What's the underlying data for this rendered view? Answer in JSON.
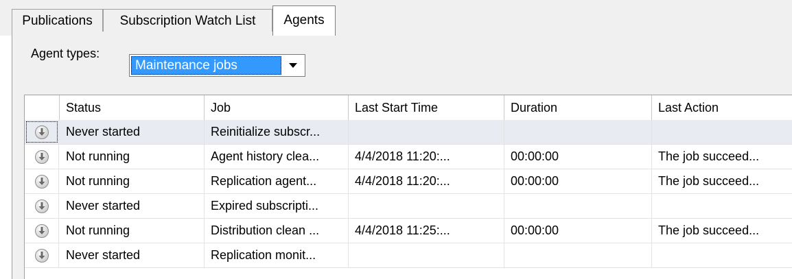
{
  "tabs": [
    {
      "label": "Publications"
    },
    {
      "label": "Subscription Watch List"
    },
    {
      "label": "Agents"
    }
  ],
  "agent_types": {
    "label": "Agent types:",
    "selected": "Maintenance jobs"
  },
  "grid": {
    "columns": [
      "",
      "Status",
      "Job",
      "Last Start Time",
      "Duration",
      "Last Action"
    ],
    "rows": [
      {
        "icon": "job-status-icon",
        "status": "Never started",
        "job": "Reinitialize subscr...",
        "last_start": "",
        "duration": "",
        "last_action": ""
      },
      {
        "icon": "job-status-icon",
        "status": "Not running",
        "job": "Agent history clea...",
        "last_start": "4/4/2018 11:20:...",
        "duration": "00:00:00",
        "last_action": "The job succeed..."
      },
      {
        "icon": "job-status-icon",
        "status": "Not running",
        "job": "Replication agent...",
        "last_start": "4/4/2018 11:20:...",
        "duration": "00:00:00",
        "last_action": "The job succeed..."
      },
      {
        "icon": "job-status-icon",
        "status": "Never started",
        "job": "Expired subscripti...",
        "last_start": "",
        "duration": "",
        "last_action": ""
      },
      {
        "icon": "job-status-icon",
        "status": "Not running",
        "job": "Distribution clean ...",
        "last_start": "4/4/2018 11:25:...",
        "duration": "00:00:00",
        "last_action": "The job succeed..."
      },
      {
        "icon": "job-status-icon",
        "status": "Never started",
        "job": "Replication monit...",
        "last_start": "",
        "duration": "",
        "last_action": ""
      }
    ]
  },
  "colors": {
    "selection": "#3399ff",
    "panel": "#f0f0f0"
  }
}
